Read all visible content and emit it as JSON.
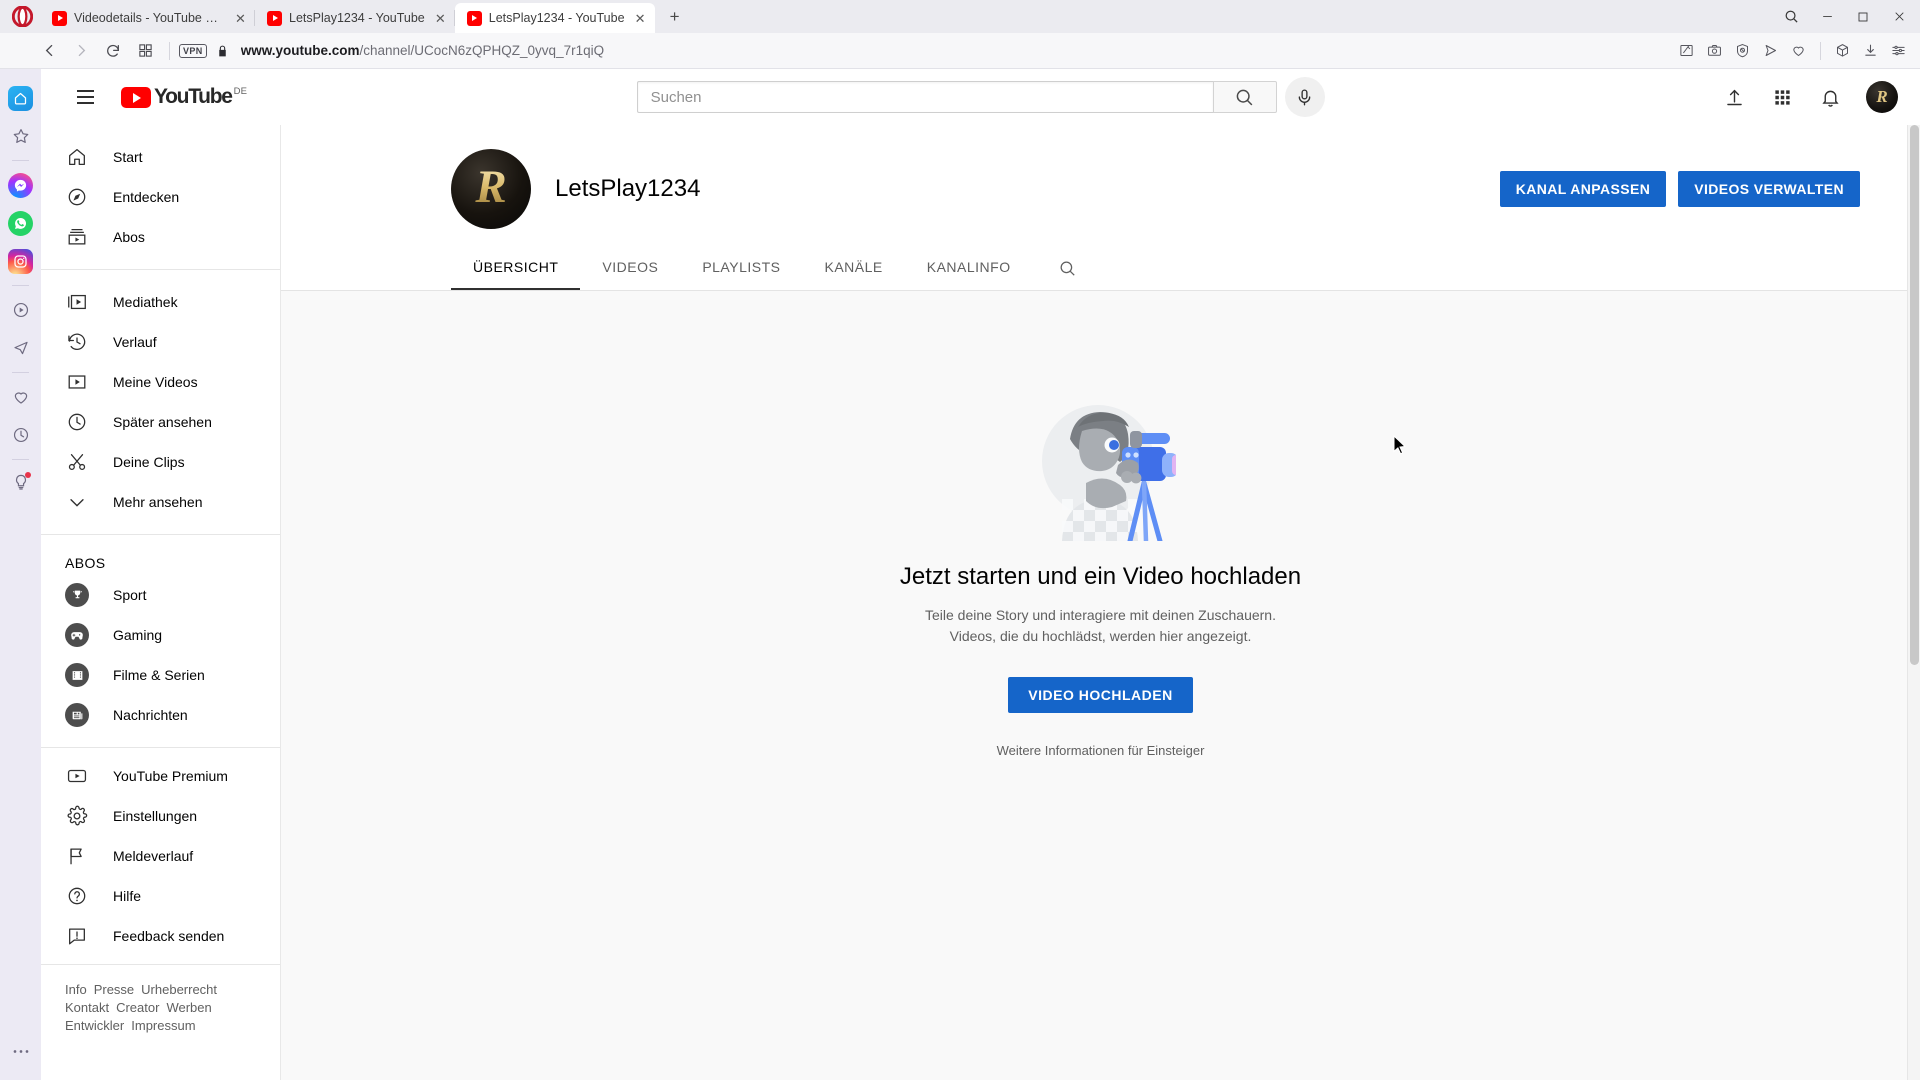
{
  "browser": {
    "name": "Opera",
    "tabs": [
      {
        "title": "Videodetails - YouTube St...",
        "favicon": "youtube-favicon",
        "active": false
      },
      {
        "title": "LetsPlay1234 - YouTube",
        "favicon": "youtube-favicon",
        "active": false
      },
      {
        "title": "LetsPlay1234 - YouTube",
        "favicon": "youtube-favicon",
        "active": true
      }
    ],
    "new_tab_label": "+",
    "window_controls": {
      "search": "search-icon",
      "minimize": "–",
      "maximize": "▢",
      "close": "✕"
    },
    "toolbar": {
      "back": "back-arrow-icon",
      "forward": "forward-arrow-icon",
      "reload": "reload-icon",
      "tab_overview": "grid-icon",
      "vpn_badge": "VPN",
      "lock": "lock-icon",
      "url_protocol": "www.youtube.com",
      "url_path": "/channel/UCocN6zQPHQZ_0yvq_7r1qiQ",
      "url_full": "www.youtube.com/channel/UCocN6zQPHQZ_0yvq_7r1qiQ",
      "right_icons": [
        "edit-pen-icon",
        "camera-snapshot-icon",
        "adblock-shield-icon",
        "send-share-icon",
        "heart-icon",
        "crypto-wallet-icon",
        "download-icon",
        "easy-setup-sliders-icon"
      ]
    },
    "sidebar_icons": [
      "opera-home-icon",
      "bookmarks-star-icon",
      "messenger-icon",
      "whatsapp-icon",
      "instagram-icon",
      "player-icon",
      "telegram-icon",
      "heart-icon",
      "history-clock-icon",
      "tips-bulb-icon"
    ]
  },
  "youtube": {
    "header": {
      "menu": "hamburger-menu-icon",
      "logo_text": "YouTube",
      "logo_country": "DE",
      "search_placeholder": "Suchen",
      "search_value": "",
      "search_button": "search-icon",
      "mic_button": "microphone-icon",
      "upload_button": "upload-video-icon",
      "apps_button": "youtube-apps-grid-icon",
      "notifications_button": "notifications-bell-icon",
      "avatar_letter": "R"
    },
    "sidebar": {
      "primary": [
        {
          "label": "Start",
          "icon": "home-icon"
        },
        {
          "label": "Entdecken",
          "icon": "compass-explore-icon"
        },
        {
          "label": "Abos",
          "icon": "subscriptions-icon"
        }
      ],
      "library": [
        {
          "label": "Mediathek",
          "icon": "library-icon"
        },
        {
          "label": "Verlauf",
          "icon": "history-icon"
        },
        {
          "label": "Meine Videos",
          "icon": "my-videos-icon"
        },
        {
          "label": "Später ansehen",
          "icon": "watch-later-clock-icon"
        },
        {
          "label": "Deine Clips",
          "icon": "clips-scissors-icon"
        },
        {
          "label": "Mehr ansehen",
          "icon": "chevron-down-icon"
        }
      ],
      "subscriptions_title": "ABOS",
      "subscriptions": [
        {
          "label": "Sport",
          "icon": "trophy-icon"
        },
        {
          "label": "Gaming",
          "icon": "gamepad-icon"
        },
        {
          "label": "Filme & Serien",
          "icon": "film-icon"
        },
        {
          "label": "Nachrichten",
          "icon": "newspaper-icon"
        }
      ],
      "more": [
        {
          "label": "YouTube Premium",
          "icon": "youtube-premium-icon"
        },
        {
          "label": "Einstellungen",
          "icon": "gear-icon"
        },
        {
          "label": "Meldeverlauf",
          "icon": "flag-icon"
        },
        {
          "label": "Hilfe",
          "icon": "help-question-icon"
        },
        {
          "label": "Feedback senden",
          "icon": "feedback-icon"
        }
      ],
      "footer_links": [
        "Info",
        "Presse",
        "Urheberrecht",
        "Kontakt",
        "Creator",
        "Werben",
        "Entwickler",
        "Impressum"
      ]
    },
    "channel": {
      "avatar_letter": "R",
      "name": "LetsPlay1234",
      "buttons": {
        "customize": "KANAL ANPASSEN",
        "manage_videos": "VIDEOS VERWALTEN"
      },
      "tabs": [
        {
          "label": "ÜBERSICHT",
          "active": true
        },
        {
          "label": "VIDEOS",
          "active": false
        },
        {
          "label": "PLAYLISTS",
          "active": false
        },
        {
          "label": "KANÄLE",
          "active": false
        },
        {
          "label": "KANALINFO",
          "active": false
        }
      ],
      "tab_search_icon": "search-icon"
    },
    "empty_state": {
      "illustration": "creator-with-camera-illustration",
      "title": "Jetzt starten und ein Video hochladen",
      "subtitle": "Teile deine Story und interagiere mit deinen Zuschauern. Videos, die du hochlädst, werden hier angezeigt.",
      "button": "VIDEO HOCHLADEN",
      "link": "Weitere Informationen für Einsteiger"
    }
  },
  "colors": {
    "youtube_red": "#ff0000",
    "action_blue": "#1565c9",
    "opera_red": "#c4182b",
    "page_bg": "#f9f9f9",
    "sidebar_bg": "#eceaf4"
  }
}
